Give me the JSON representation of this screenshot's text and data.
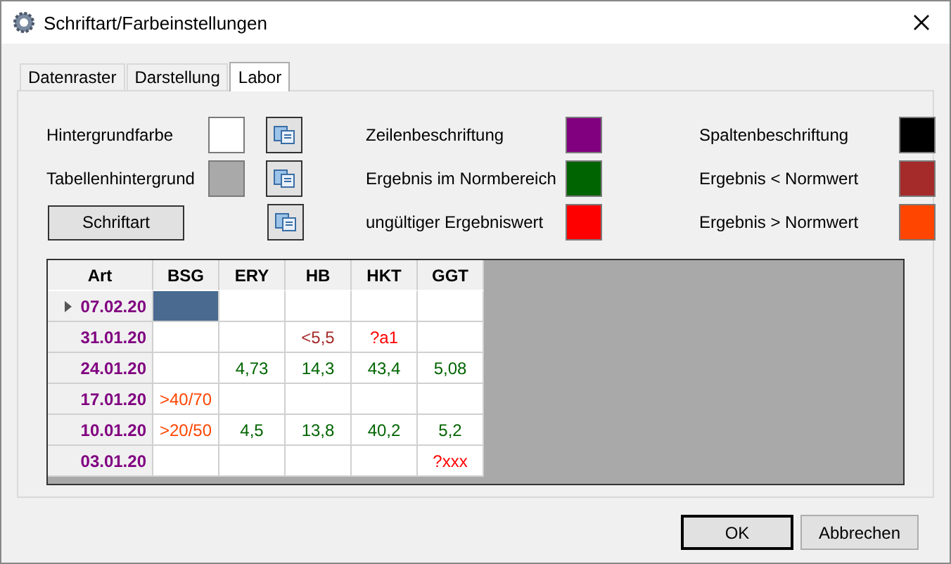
{
  "window": {
    "title": "Schriftart/Farbeinstellungen"
  },
  "tabs": [
    {
      "label": "Datenraster",
      "selected": false
    },
    {
      "label": "Darstellung",
      "selected": false
    },
    {
      "label": "Labor",
      "selected": true
    }
  ],
  "settings": {
    "left": [
      {
        "kind": "color",
        "label": "Hintergrundfarbe",
        "color": "#ffffff"
      },
      {
        "kind": "color",
        "label": "Tabellenhintergrund",
        "color": "#a9a9a9"
      },
      {
        "kind": "button",
        "label": "Schriftart"
      }
    ],
    "middle": [
      {
        "label": "Zeilenbeschriftung",
        "color": "#800080"
      },
      {
        "label": "Ergebnis im Normbereich",
        "color": "#006400"
      },
      {
        "label": "ungültiger Ergebniswert",
        "color": "#ff0000"
      }
    ],
    "right": [
      {
        "label": "Spaltenbeschriftung",
        "color": "#000000"
      },
      {
        "label": "Ergebnis < Normwert",
        "color": "#a52a2a"
      },
      {
        "label": "Ergebnis > Normwert",
        "color": "#ff4500"
      }
    ]
  },
  "grid": {
    "columns": [
      "Art",
      "BSG",
      "ERY",
      "HB",
      "HKT",
      "GGT"
    ],
    "rows": [
      {
        "current": true,
        "cells": [
          {
            "text": "07.02.20",
            "kind": "date"
          },
          {
            "text": "",
            "kind": "normal",
            "selected": true
          },
          {
            "text": "",
            "kind": "normal",
            "selected": false
          },
          {
            "text": "",
            "kind": "normal",
            "selected": false
          },
          {
            "text": "",
            "kind": "normal",
            "selected": false
          },
          {
            "text": "",
            "kind": "normal",
            "selected": false
          }
        ]
      },
      {
        "current": false,
        "cells": [
          {
            "text": "31.01.20",
            "kind": "date"
          },
          {
            "text": "",
            "kind": "normal",
            "selected": false
          },
          {
            "text": "",
            "kind": "normal",
            "selected": false
          },
          {
            "text": "<5,5",
            "kind": "low",
            "selected": false
          },
          {
            "text": "?a1",
            "kind": "invalid",
            "selected": false
          },
          {
            "text": "",
            "kind": "normal",
            "selected": false
          }
        ]
      },
      {
        "current": false,
        "cells": [
          {
            "text": "24.01.20",
            "kind": "date"
          },
          {
            "text": "",
            "kind": "normal",
            "selected": false
          },
          {
            "text": "4,73",
            "kind": "normal",
            "selected": false
          },
          {
            "text": "14,3",
            "kind": "normal",
            "selected": false
          },
          {
            "text": "43,4",
            "kind": "normal",
            "selected": false
          },
          {
            "text": "5,08",
            "kind": "normal",
            "selected": false
          }
        ]
      },
      {
        "current": false,
        "cells": [
          {
            "text": "17.01.20",
            "kind": "date"
          },
          {
            "text": ">40/70",
            "kind": "high",
            "selected": false
          },
          {
            "text": "",
            "kind": "normal",
            "selected": false
          },
          {
            "text": "",
            "kind": "normal",
            "selected": false
          },
          {
            "text": "",
            "kind": "normal",
            "selected": false
          },
          {
            "text": "",
            "kind": "normal",
            "selected": false
          }
        ]
      },
      {
        "current": false,
        "cells": [
          {
            "text": "10.01.20",
            "kind": "date"
          },
          {
            "text": ">20/50",
            "kind": "high",
            "selected": false
          },
          {
            "text": "4,5",
            "kind": "normal",
            "selected": false
          },
          {
            "text": "13,8",
            "kind": "normal",
            "selected": false
          },
          {
            "text": "40,2",
            "kind": "normal",
            "selected": false
          },
          {
            "text": "5,2",
            "kind": "normal",
            "selected": false
          }
        ]
      },
      {
        "current": false,
        "cells": [
          {
            "text": "03.01.20",
            "kind": "date"
          },
          {
            "text": "",
            "kind": "normal",
            "selected": false
          },
          {
            "text": "",
            "kind": "normal",
            "selected": false
          },
          {
            "text": "",
            "kind": "normal",
            "selected": false
          },
          {
            "text": "",
            "kind": "normal",
            "selected": false
          },
          {
            "text": "?xxx",
            "kind": "invalid",
            "selected": false
          }
        ]
      }
    ]
  },
  "buttons": [
    {
      "label": "OK",
      "default": true
    },
    {
      "label": "Abbrechen",
      "default": false
    }
  ]
}
